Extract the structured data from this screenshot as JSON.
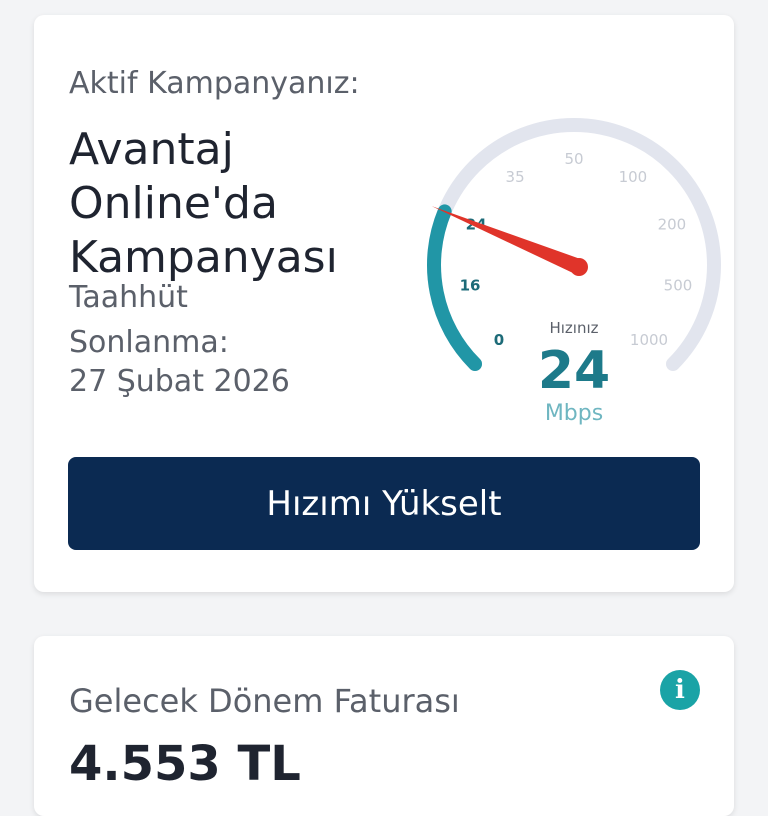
{
  "campaign_card": {
    "active_label": "Aktif Kampanyanız:",
    "campaign_name": "Avantaj Online'da Kampanyası",
    "term_end_label": "Taahhüt Sonlanma:",
    "term_end_date": "27 Şubat 2026",
    "upgrade_button_label": "Hızımı Yükselt"
  },
  "speed_gauge": {
    "speed_label": "Hızınız",
    "speed_value": 24,
    "speed_value_text": "24",
    "unit": "Mbps",
    "tick_labels": [
      "0",
      "16",
      "24",
      "35",
      "50",
      "100",
      "200",
      "500",
      "1000"
    ],
    "active_color": "#2196a6",
    "inactive_color": "#e2e5ee",
    "needle_color": "#e0342a"
  },
  "invoice_card": {
    "title": "Gelecek Dönem Faturası",
    "amount": "4.553 TL",
    "info_icon": "info-icon"
  },
  "colors": {
    "primary_button": "#0b2a52",
    "accent": "#1aa3a6"
  }
}
